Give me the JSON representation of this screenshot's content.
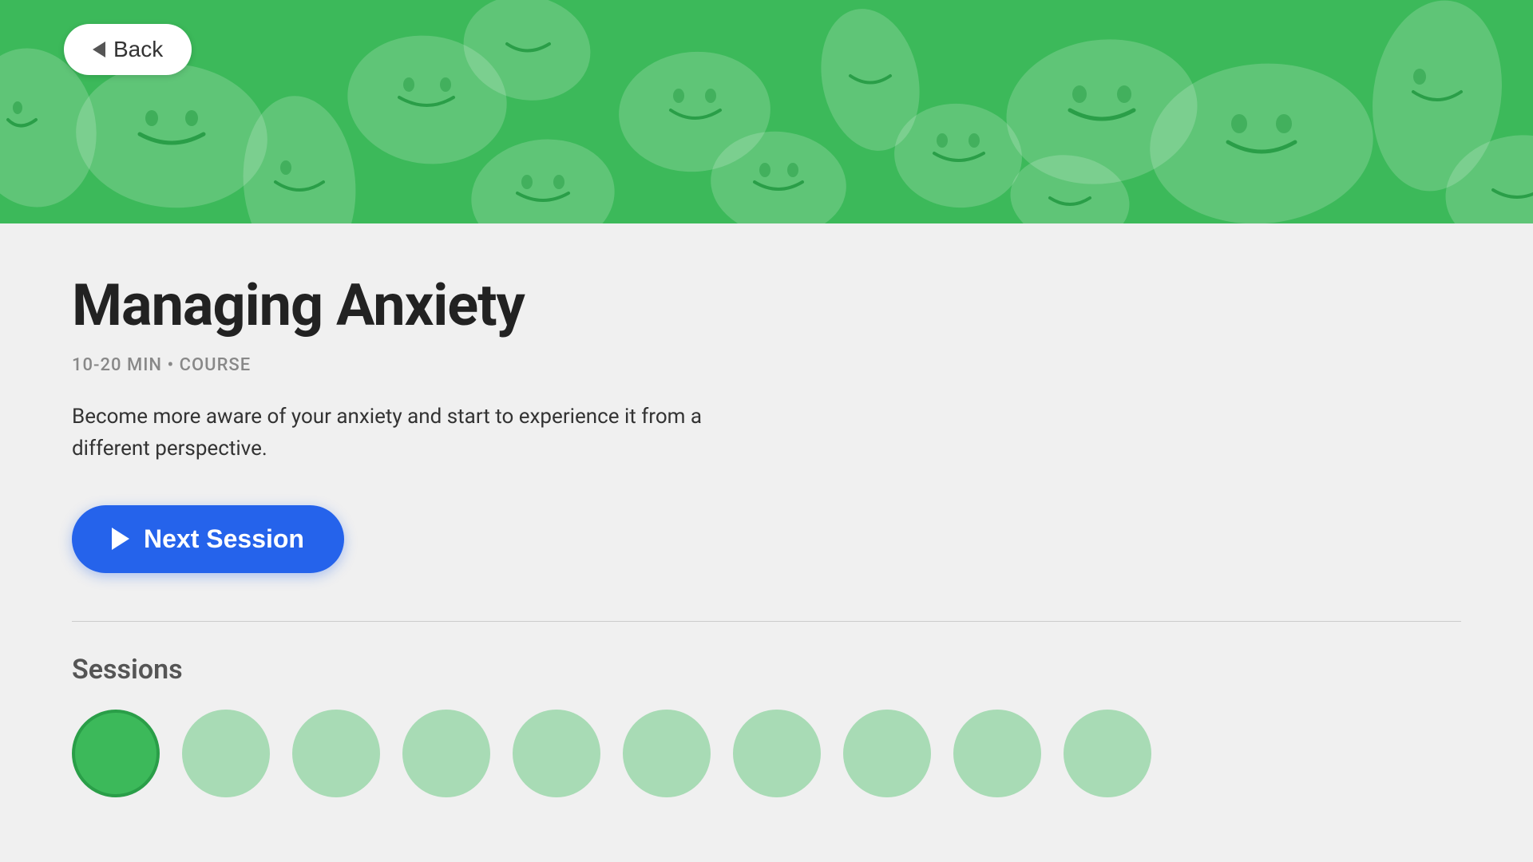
{
  "hero": {
    "background_color": "#3cb95a"
  },
  "back_button": {
    "label": "Back"
  },
  "course": {
    "title": "Managing Anxiety",
    "meta": "10-20 MIN • COURSE",
    "description": "Become more aware of your anxiety and start to experience it from a different perspective."
  },
  "next_session_button": {
    "label": "Next Session"
  },
  "sessions_section": {
    "title": "Sessions"
  },
  "sessions": [
    {
      "id": 1,
      "active": true
    },
    {
      "id": 2,
      "active": false
    },
    {
      "id": 3,
      "active": false
    },
    {
      "id": 4,
      "active": false
    },
    {
      "id": 5,
      "active": false
    },
    {
      "id": 6,
      "active": false
    },
    {
      "id": 7,
      "active": false
    },
    {
      "id": 8,
      "active": false
    },
    {
      "id": 9,
      "active": false
    },
    {
      "id": 10,
      "active": false
    }
  ]
}
